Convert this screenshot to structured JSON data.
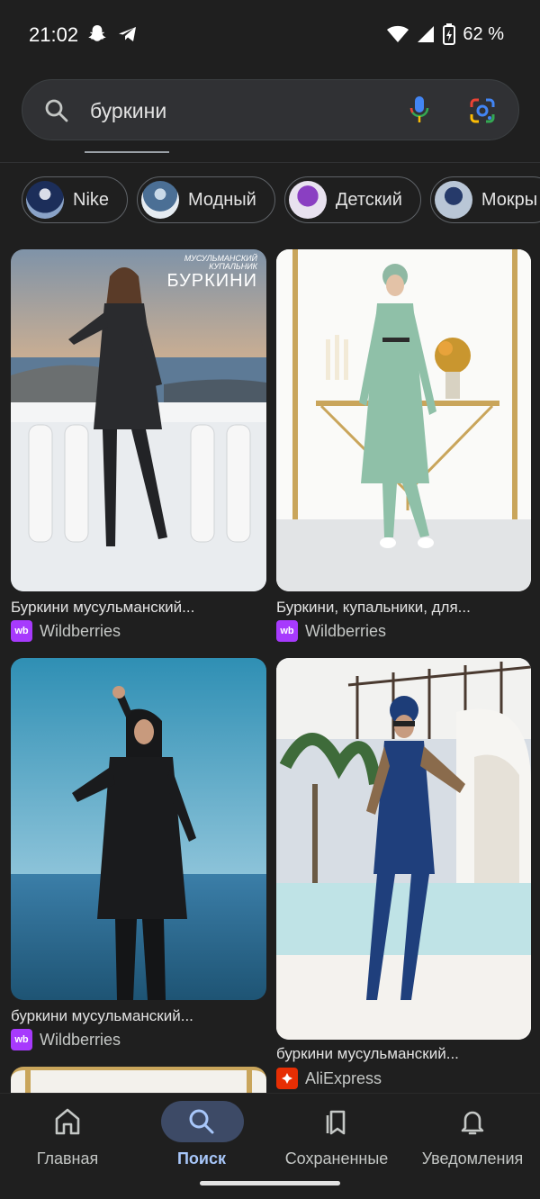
{
  "status_bar": {
    "time": "21:02",
    "battery": "62 %"
  },
  "search": {
    "query": "буркини"
  },
  "chips": [
    {
      "label": "Nike"
    },
    {
      "label": "Модный"
    },
    {
      "label": "Детский"
    },
    {
      "label": "Мокры"
    }
  ],
  "results": [
    {
      "title": "Буркини мусульманский...",
      "source": "Wildberries",
      "image_caption_1": "МУСУЛЬМАНСКИЙ",
      "image_caption_2": "КУПАЛЬНИК",
      "image_caption_3": "БУРКИНИ"
    },
    {
      "title": "Буркини, купальники, для...",
      "source": "Wildberries"
    },
    {
      "title": "буркини мусульманский...",
      "source": "Wildberries"
    },
    {
      "title": "буркини мусульманский...",
      "source": "AliExpress"
    }
  ],
  "source_logos": {
    "wildberries": "wb"
  },
  "bottom_nav": [
    {
      "label": "Главная",
      "active": false
    },
    {
      "label": "Поиск",
      "active": true
    },
    {
      "label": "Сохраненные",
      "active": false
    },
    {
      "label": "Уведомления",
      "active": false
    }
  ],
  "colors": {
    "background": "#1f1f1f",
    "search_box": "#303134",
    "active_pill": "#3d4a66",
    "active_label": "#a8c7fa",
    "wildberries": "#a73afd",
    "aliexpress": "#e62e04"
  }
}
